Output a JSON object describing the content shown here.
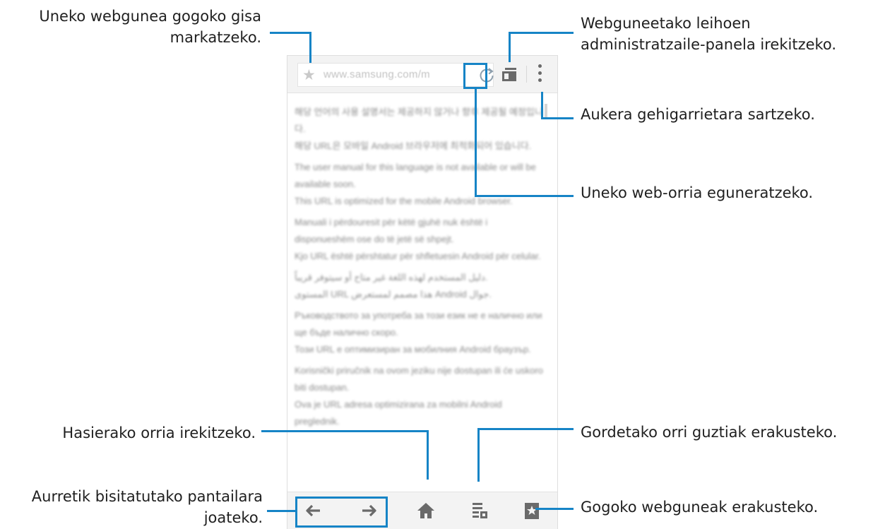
{
  "browser": {
    "url": "www.samsung.com/m",
    "icons": {
      "bookmark": "star-icon",
      "refresh": "refresh-icon",
      "windows": "windows-icon",
      "more": "more-options-icon",
      "back": "arrow-left-icon",
      "forward": "arrow-right-icon",
      "home": "home-icon",
      "saved": "saved-pages-icon",
      "bookmarks": "bookmarks-icon"
    },
    "content": [
      "해당 언어의 사용 설명서는 제공하지 않거나 향후 제공될 예정입니다.",
      "해당 URL은 모바일 Android 브라우저에 최적화되어 있습니다.",
      "The user manual for this language is not available or will be available soon.",
      "This URL is optimized for the mobile Android browser.",
      "Manuali i përdouresit për këtë gjuhë nuk është i disponueshëm ose do të jetë së shpejt.",
      "Kjo URL është përshtatur për shfletuesin Android për celular.",
      "دليل المستخدم لهذه اللغة غير متاح أو سيتوفر قريباً.",
      "المستوى URL هذا مصمم لمستعرض Android جوال.",
      "Ръководството за употреба за този език не е налично или ще бъде налично скоро.",
      "Този URL е оптимизиран за мобилния Android браузър.",
      "Korisnički priručnik na ovom jeziku nije dostupan ili će uskoro biti dostupan.",
      "Ova je URL adresa optimizirana za mobilni Android preglednik."
    ]
  },
  "callouts": {
    "bookmark": "Uneko webgunea gogoko gisa\nmarkatzeko.",
    "windows": "Webguneetako leihoen\nadministratzaile-panela irekitzeko.",
    "more": "Aukera gehigarrietara sartzeko.",
    "refresh": "Uneko web-orria eguneratzeko.",
    "home": "Hasierako orria irekitzeko.",
    "saved": "Gordetako orri guztiak erakusteko.",
    "navigate": "Aurretik bisitatutako pantailara\njoateko.",
    "bookmarks": "Gogoko webguneak erakusteko."
  },
  "colors": {
    "accent": "#1684c6",
    "icon": "#6a6a6a",
    "bar": "#f3f3f3"
  }
}
